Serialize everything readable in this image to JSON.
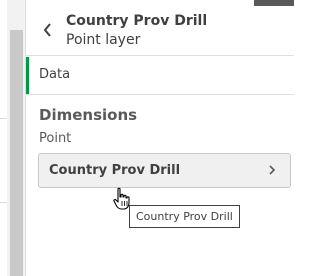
{
  "header": {
    "title": "Country Prov Drill",
    "subtitle": "Point layer",
    "back_icon": "chevron-left-icon"
  },
  "sections": {
    "data_label": "Data"
  },
  "dimensions": {
    "heading": "Dimensions",
    "group_label": "Point",
    "item_label": "Country Prov Drill",
    "item_icon": "chevron-right-icon"
  },
  "tooltip": {
    "text": "Country Prov Drill"
  },
  "colors": {
    "accent": "#009845",
    "text": "#404040",
    "button_bg": "#f0f0f0"
  }
}
